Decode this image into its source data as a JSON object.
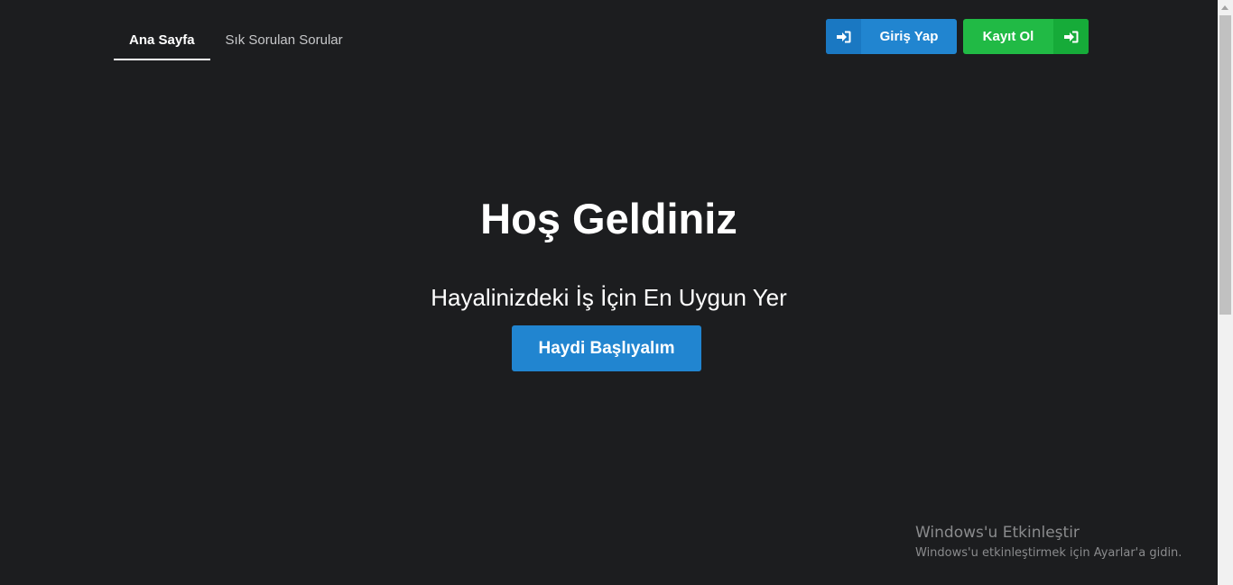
{
  "nav": {
    "items": [
      {
        "label": "Ana Sayfa",
        "active": true
      },
      {
        "label": "Sık Sorulan Sorular",
        "active": false
      }
    ]
  },
  "auth": {
    "login_label": "Giriş Yap",
    "login_icon": "sign-in-icon",
    "register_label": "Kayıt Ol",
    "register_icon": "sign-in-icon"
  },
  "hero": {
    "title": "Hoş Geldiniz",
    "subtitle": "Hayalinizdeki İş İçin En Uygun Yer",
    "cta_label": "Haydi Başlıyalım"
  },
  "watermark": {
    "title": "Windows'u Etkinleştir",
    "subtitle": "Windows'u etkinleştirmek için Ayarlar'a gidin."
  },
  "colors": {
    "background": "#1c1d1f",
    "primary_blue": "#2185d0",
    "success_green": "#21ba45",
    "text_white": "#ffffff"
  }
}
